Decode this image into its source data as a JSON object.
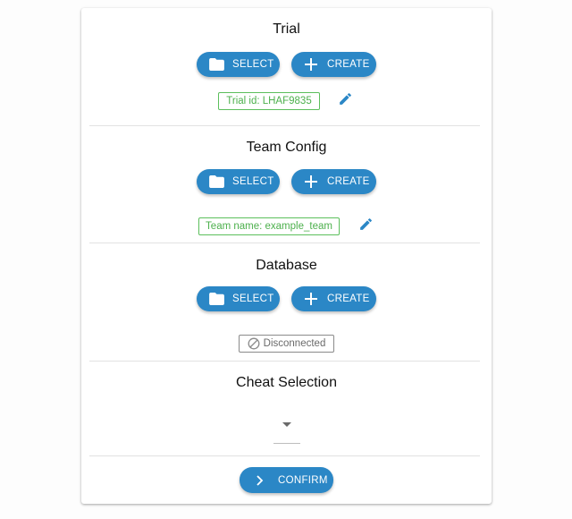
{
  "colors": {
    "accent": "#2b87c6",
    "success": "#4db04d",
    "muted": "#6a6a6a"
  },
  "trial": {
    "title": "Trial",
    "select_label": "SELECT",
    "create_label": "CREATE",
    "status_chip": "Trial id: LHAF9835",
    "icons": {
      "select": "folder-icon",
      "create": "plus-icon",
      "edit": "pencil-icon"
    }
  },
  "team_config": {
    "title": "Team Config",
    "select_label": "SELECT",
    "create_label": "CREATE",
    "status_chip": "Team name: example_team",
    "icons": {
      "select": "folder-icon",
      "create": "plus-icon",
      "edit": "pencil-icon"
    }
  },
  "database": {
    "title": "Database",
    "select_label": "SELECT",
    "create_label": "CREATE",
    "status_chip": "Disconnected",
    "icons": {
      "select": "folder-icon",
      "create": "plus-icon",
      "status": "block-icon"
    }
  },
  "cheat_selection": {
    "title": "Cheat Selection",
    "selected_value": ""
  },
  "confirm": {
    "label": "CONFIRM",
    "icon": "chevron-right-icon"
  }
}
